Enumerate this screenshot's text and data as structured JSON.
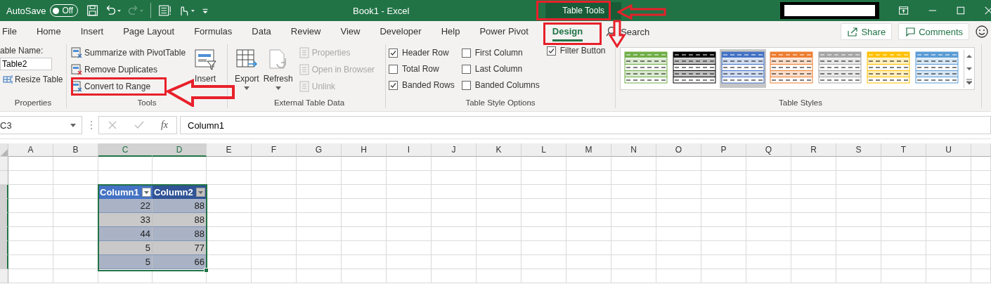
{
  "title_bar": {
    "autosave_label": "AutoSave",
    "autosave_on": false,
    "autosave_state": "Off",
    "title": "Book1  -  Excel",
    "contextual_tab": "Table Tools"
  },
  "tabs": [
    {
      "label": "File",
      "selected": false
    },
    {
      "label": "Home",
      "selected": false
    },
    {
      "label": "Insert",
      "selected": false
    },
    {
      "label": "Page Layout",
      "selected": false
    },
    {
      "label": "Formulas",
      "selected": false
    },
    {
      "label": "Data",
      "selected": false
    },
    {
      "label": "Review",
      "selected": false
    },
    {
      "label": "View",
      "selected": false
    },
    {
      "label": "Developer",
      "selected": false
    },
    {
      "label": "Help",
      "selected": false
    },
    {
      "label": "Power Pivot",
      "selected": false
    },
    {
      "label": "Design",
      "selected": true
    }
  ],
  "search": {
    "placeholder": "Search"
  },
  "share": "Share",
  "comments": "Comments",
  "properties": {
    "name_label": "able Name:",
    "name_value": "Table2",
    "resize": "Resize Table",
    "group": "Properties"
  },
  "tools": {
    "items": [
      {
        "label": "Summarize with PivotTable",
        "disabled": false
      },
      {
        "label": "Remove Duplicates",
        "disabled": false
      },
      {
        "label": "Convert to Range",
        "disabled": false
      }
    ],
    "insert": "Insert",
    "group": "Tools"
  },
  "external": {
    "export": "Export",
    "refresh": "Refresh",
    "items": [
      {
        "label": "Properties",
        "disabled": true
      },
      {
        "label": "Open in Browser",
        "disabled": true
      },
      {
        "label": "Unlink",
        "disabled": true
      }
    ],
    "group": "External Table Data"
  },
  "style_options": {
    "options": [
      {
        "label": "Header Row",
        "checked": true
      },
      {
        "label": "Total Row",
        "checked": false
      },
      {
        "label": "Banded Rows",
        "checked": true
      },
      {
        "label": "First Column",
        "checked": false
      },
      {
        "label": "Last Column",
        "checked": false
      },
      {
        "label": "Banded Columns",
        "checked": false
      },
      {
        "label": "Filter Button",
        "checked": true
      }
    ],
    "group": "Table Style Options"
  },
  "table_styles": {
    "styles": [
      {
        "color": "#70ad47",
        "selected": false
      },
      {
        "color": "#000000",
        "selected": false
      },
      {
        "color": "#4472c4",
        "selected": true
      },
      {
        "color": "#ed7d31",
        "selected": false
      },
      {
        "color": "#a5a5a5",
        "selected": false
      },
      {
        "color": "#ffc000",
        "selected": false
      },
      {
        "color": "#5b9bd5",
        "selected": false
      }
    ],
    "group": "Table Styles"
  },
  "formula_bar": {
    "name_box": "C3",
    "function_label": "fx",
    "formula": "Column1"
  },
  "sheet": {
    "columns": [
      {
        "label": "A",
        "selected": false
      },
      {
        "label": "B",
        "selected": false
      },
      {
        "label": "C",
        "selected": true
      },
      {
        "label": "D",
        "selected": true
      },
      {
        "label": "E",
        "selected": false
      },
      {
        "label": "F",
        "selected": false
      },
      {
        "label": "G",
        "selected": false
      },
      {
        "label": "H",
        "selected": false
      },
      {
        "label": "I",
        "selected": false
      },
      {
        "label": "J",
        "selected": false
      },
      {
        "label": "K",
        "selected": false
      },
      {
        "label": "L",
        "selected": false
      },
      {
        "label": "M",
        "selected": false
      },
      {
        "label": "N",
        "selected": false
      },
      {
        "label": "O",
        "selected": false
      },
      {
        "label": "P",
        "selected": false
      },
      {
        "label": "Q",
        "selected": false
      },
      {
        "label": "R",
        "selected": false
      },
      {
        "label": "S",
        "selected": false
      },
      {
        "label": "T",
        "selected": false
      },
      {
        "label": "U",
        "selected": false
      }
    ]
  },
  "table": {
    "headers": [
      "Column1",
      "Column2"
    ],
    "rows": [
      [
        "22",
        "88"
      ],
      [
        "33",
        "88"
      ],
      [
        "44",
        "88"
      ],
      [
        "5",
        "77"
      ],
      [
        "5",
        "66"
      ]
    ]
  }
}
